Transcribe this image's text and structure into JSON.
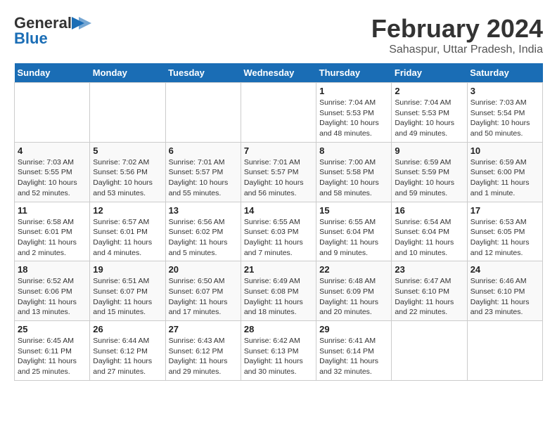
{
  "logo": {
    "text_general": "General",
    "text_blue": "Blue",
    "arrow": "▶"
  },
  "title": "February 2024",
  "subtitle": "Sahaspur, Uttar Pradesh, India",
  "weekdays": [
    "Sunday",
    "Monday",
    "Tuesday",
    "Wednesday",
    "Thursday",
    "Friday",
    "Saturday"
  ],
  "weeks": [
    [
      {
        "day": "",
        "info": ""
      },
      {
        "day": "",
        "info": ""
      },
      {
        "day": "",
        "info": ""
      },
      {
        "day": "",
        "info": ""
      },
      {
        "day": "1",
        "info": "Sunrise: 7:04 AM\nSunset: 5:53 PM\nDaylight: 10 hours\nand 48 minutes."
      },
      {
        "day": "2",
        "info": "Sunrise: 7:04 AM\nSunset: 5:53 PM\nDaylight: 10 hours\nand 49 minutes."
      },
      {
        "day": "3",
        "info": "Sunrise: 7:03 AM\nSunset: 5:54 PM\nDaylight: 10 hours\nand 50 minutes."
      }
    ],
    [
      {
        "day": "4",
        "info": "Sunrise: 7:03 AM\nSunset: 5:55 PM\nDaylight: 10 hours\nand 52 minutes."
      },
      {
        "day": "5",
        "info": "Sunrise: 7:02 AM\nSunset: 5:56 PM\nDaylight: 10 hours\nand 53 minutes."
      },
      {
        "day": "6",
        "info": "Sunrise: 7:01 AM\nSunset: 5:57 PM\nDaylight: 10 hours\nand 55 minutes."
      },
      {
        "day": "7",
        "info": "Sunrise: 7:01 AM\nSunset: 5:57 PM\nDaylight: 10 hours\nand 56 minutes."
      },
      {
        "day": "8",
        "info": "Sunrise: 7:00 AM\nSunset: 5:58 PM\nDaylight: 10 hours\nand 58 minutes."
      },
      {
        "day": "9",
        "info": "Sunrise: 6:59 AM\nSunset: 5:59 PM\nDaylight: 10 hours\nand 59 minutes."
      },
      {
        "day": "10",
        "info": "Sunrise: 6:59 AM\nSunset: 6:00 PM\nDaylight: 11 hours\nand 1 minute."
      }
    ],
    [
      {
        "day": "11",
        "info": "Sunrise: 6:58 AM\nSunset: 6:01 PM\nDaylight: 11 hours\nand 2 minutes."
      },
      {
        "day": "12",
        "info": "Sunrise: 6:57 AM\nSunset: 6:01 PM\nDaylight: 11 hours\nand 4 minutes."
      },
      {
        "day": "13",
        "info": "Sunrise: 6:56 AM\nSunset: 6:02 PM\nDaylight: 11 hours\nand 5 minutes."
      },
      {
        "day": "14",
        "info": "Sunrise: 6:55 AM\nSunset: 6:03 PM\nDaylight: 11 hours\nand 7 minutes."
      },
      {
        "day": "15",
        "info": "Sunrise: 6:55 AM\nSunset: 6:04 PM\nDaylight: 11 hours\nand 9 minutes."
      },
      {
        "day": "16",
        "info": "Sunrise: 6:54 AM\nSunset: 6:04 PM\nDaylight: 11 hours\nand 10 minutes."
      },
      {
        "day": "17",
        "info": "Sunrise: 6:53 AM\nSunset: 6:05 PM\nDaylight: 11 hours\nand 12 minutes."
      }
    ],
    [
      {
        "day": "18",
        "info": "Sunrise: 6:52 AM\nSunset: 6:06 PM\nDaylight: 11 hours\nand 13 minutes."
      },
      {
        "day": "19",
        "info": "Sunrise: 6:51 AM\nSunset: 6:07 PM\nDaylight: 11 hours\nand 15 minutes."
      },
      {
        "day": "20",
        "info": "Sunrise: 6:50 AM\nSunset: 6:07 PM\nDaylight: 11 hours\nand 17 minutes."
      },
      {
        "day": "21",
        "info": "Sunrise: 6:49 AM\nSunset: 6:08 PM\nDaylight: 11 hours\nand 18 minutes."
      },
      {
        "day": "22",
        "info": "Sunrise: 6:48 AM\nSunset: 6:09 PM\nDaylight: 11 hours\nand 20 minutes."
      },
      {
        "day": "23",
        "info": "Sunrise: 6:47 AM\nSunset: 6:10 PM\nDaylight: 11 hours\nand 22 minutes."
      },
      {
        "day": "24",
        "info": "Sunrise: 6:46 AM\nSunset: 6:10 PM\nDaylight: 11 hours\nand 23 minutes."
      }
    ],
    [
      {
        "day": "25",
        "info": "Sunrise: 6:45 AM\nSunset: 6:11 PM\nDaylight: 11 hours\nand 25 minutes."
      },
      {
        "day": "26",
        "info": "Sunrise: 6:44 AM\nSunset: 6:12 PM\nDaylight: 11 hours\nand 27 minutes."
      },
      {
        "day": "27",
        "info": "Sunrise: 6:43 AM\nSunset: 6:12 PM\nDaylight: 11 hours\nand 29 minutes."
      },
      {
        "day": "28",
        "info": "Sunrise: 6:42 AM\nSunset: 6:13 PM\nDaylight: 11 hours\nand 30 minutes."
      },
      {
        "day": "29",
        "info": "Sunrise: 6:41 AM\nSunset: 6:14 PM\nDaylight: 11 hours\nand 32 minutes."
      },
      {
        "day": "",
        "info": ""
      },
      {
        "day": "",
        "info": ""
      }
    ]
  ]
}
